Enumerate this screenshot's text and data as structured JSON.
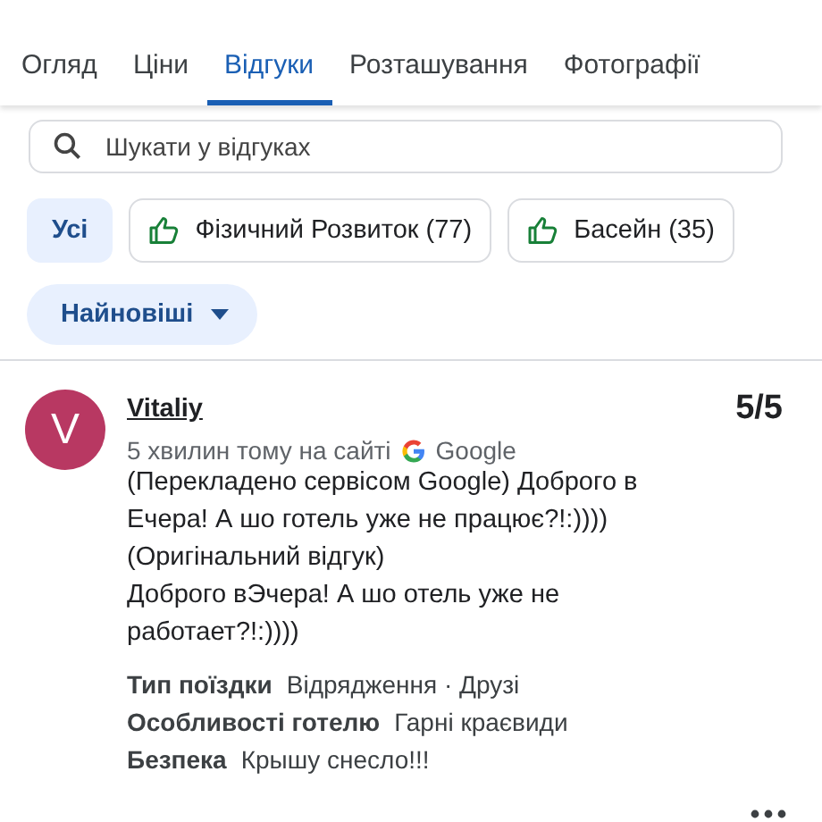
{
  "tabs": [
    {
      "label": "Огляд",
      "selected": false
    },
    {
      "label": "Ціни",
      "selected": false
    },
    {
      "label": "Відгуки",
      "selected": true
    },
    {
      "label": "Розташування",
      "selected": false
    },
    {
      "label": "Фотографії",
      "selected": false
    }
  ],
  "search": {
    "placeholder": "Шукати у відгуках"
  },
  "filters": [
    {
      "label": "Усі",
      "selected": true,
      "kind": "plain"
    },
    {
      "label": "Фізичний Розвиток (77)",
      "selected": false,
      "kind": "thumb"
    },
    {
      "label": "Басейн (35)",
      "selected": false,
      "kind": "thumb"
    }
  ],
  "sort": {
    "label": "Найновіші"
  },
  "review": {
    "avatar_letter": "V",
    "author": "Vitaliy",
    "score": "5/5",
    "time": "5 хвилин тому на сайті",
    "source": "Google",
    "text_lines": [
      "(Перекладено сервісом Google) Доброго в",
      "Ечера! А шо готель уже не працює?!:))))",
      "(Оригінальний відгук)",
      "Доброго вЭчера! А шо отель уже не",
      "работает?!:))))"
    ],
    "details": [
      {
        "label": "Тип поїздки",
        "value": "Відрядження · Друзі"
      },
      {
        "label": "Особливості готелю",
        "value": "Гарні краєвиди"
      },
      {
        "label": "Безпека",
        "value": "Крышу снесло!!!"
      }
    ]
  }
}
